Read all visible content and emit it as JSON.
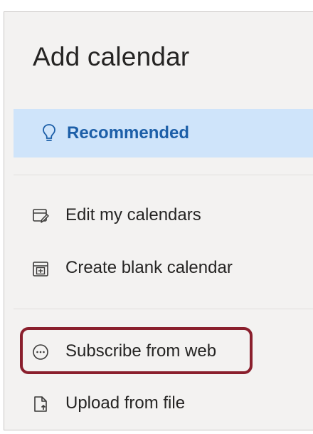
{
  "panel": {
    "title": "Add calendar"
  },
  "nav": {
    "recommended": {
      "label": "Recommended",
      "icon": "lightbulb-icon",
      "selected": true
    },
    "items": [
      {
        "label": "Edit my calendars",
        "icon": "edit-calendar-icon"
      },
      {
        "label": "Create blank calendar",
        "icon": "add-calendar-icon"
      },
      {
        "label": "Subscribe from web",
        "icon": "ellipsis-circle-icon",
        "highlighted": true
      },
      {
        "label": "Upload from file",
        "icon": "upload-file-icon"
      }
    ]
  },
  "colors": {
    "panel_bg": "#f3f2f1",
    "selected_bg": "#cfe4fa",
    "selected_text": "#1d5fa8",
    "text": "#252423",
    "highlight_border": "#8a1f2d"
  }
}
